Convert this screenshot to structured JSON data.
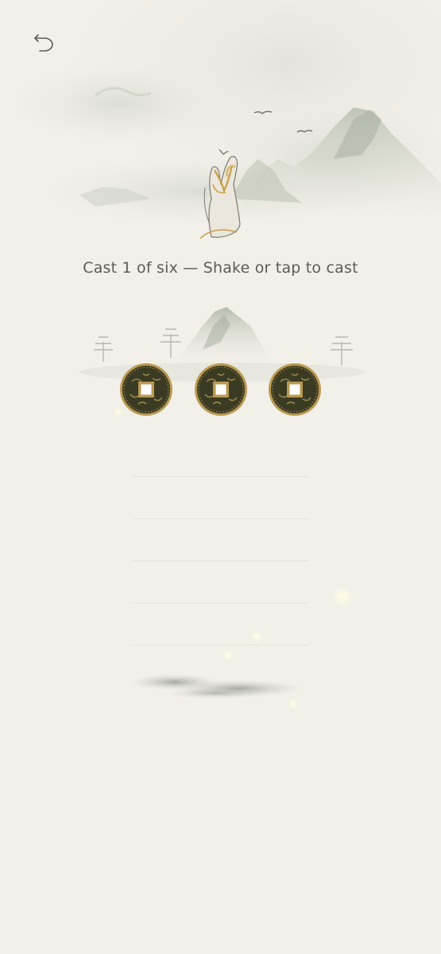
{
  "header": {
    "back_icon": "undo-arrow-icon"
  },
  "cast": {
    "prompt": "Cast 1 of six — Shake or tap to cast",
    "current": 1,
    "total": 6
  },
  "coins": [
    {
      "name": "coin-1",
      "icon": "chinese-coin-icon"
    },
    {
      "name": "coin-2",
      "icon": "chinese-coin-icon"
    },
    {
      "name": "coin-3",
      "icon": "chinese-coin-icon"
    }
  ],
  "hexagram_lines": {
    "slots": 5
  },
  "colors": {
    "background": "#f3f0ea",
    "text": "#5e5b55",
    "coin_dark": "#3b3a22",
    "coin_gold": "#b89a52"
  }
}
